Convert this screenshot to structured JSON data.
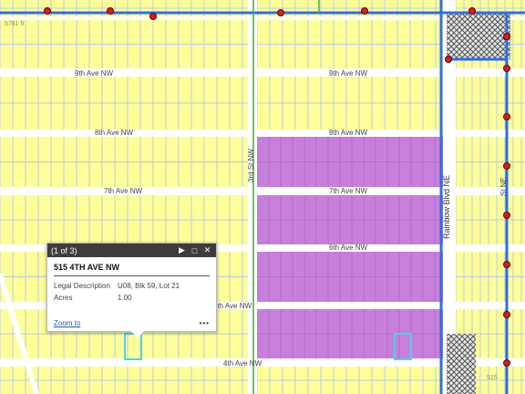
{
  "map": {
    "streets": {
      "ave_9": "9th Ave NW",
      "ave_9_east": "9th Ave NW",
      "ave_8": "8th Ave NW",
      "ave_8_east": "8th Ave NW",
      "ave_7": "7th Ave NW",
      "ave_7_east": "7th Ave NW",
      "ave_6": "6th Ave NW",
      "ave_5": "5th Ave NW",
      "ave_4": "4th Ave NW",
      "st_3rd": "3rd St NW",
      "rainbow": "Rainbow Blvd NE",
      "st_ne": "St NE"
    },
    "elevation_labels": {
      "top_left": "5781 ft",
      "bottom_right": "515"
    },
    "colors": {
      "land": "#ffff99",
      "parcel_line": "#b8c8e8",
      "street": "#ffffff",
      "selected_parcels": "#c77fdb",
      "selection_outline": "#4fd0f0",
      "water_line": "#2e6fe0",
      "green_line": "#3fae3f",
      "hatch_area": "#d8d8d8"
    }
  },
  "popup": {
    "count": "(1 of 3)",
    "title": "515 4TH AVE NW",
    "fields": [
      {
        "label": "Legal Description",
        "value": "U08, Blk 59, Lot 21"
      },
      {
        "label": "Acres",
        "value": "1.00"
      }
    ],
    "zoom_label": "Zoom to",
    "more_label": "•••",
    "next_icon": "▶",
    "maximize_icon": "□",
    "close_icon": "✕"
  }
}
